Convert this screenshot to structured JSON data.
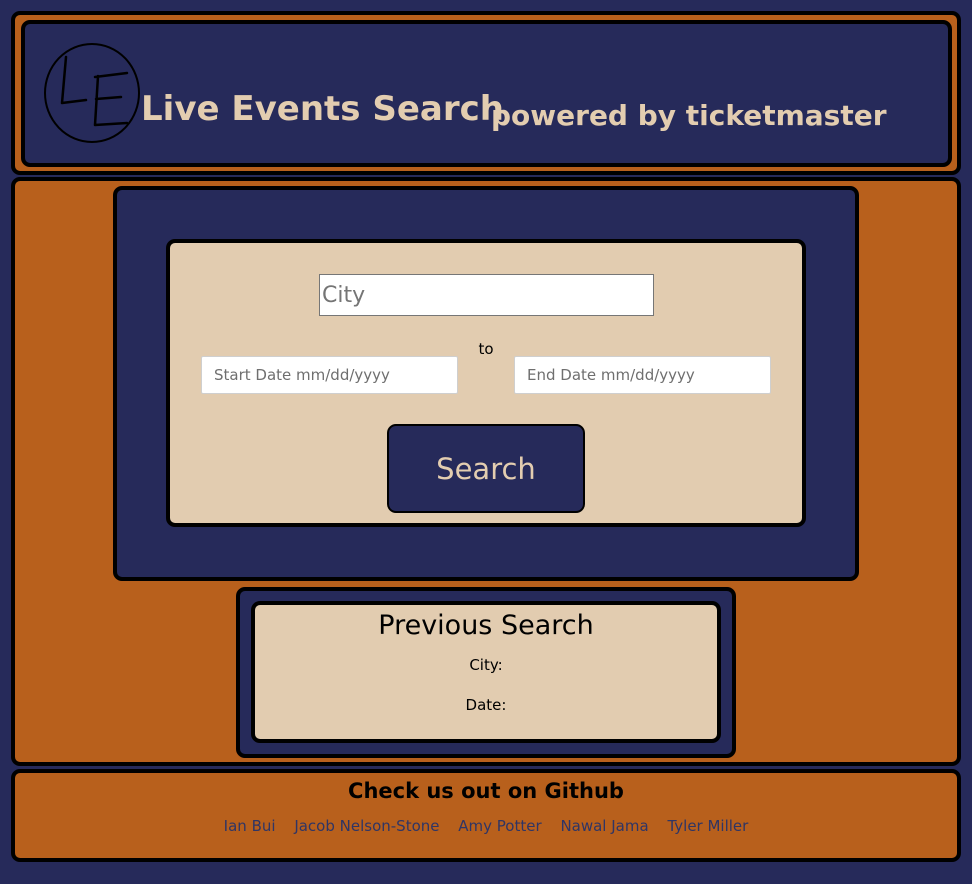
{
  "header": {
    "logo_text": "LE",
    "title": "Live Events Search",
    "subtitle": "powered by ticketmaster"
  },
  "search_form": {
    "city_placeholder": "City",
    "city_value": "",
    "start_date_placeholder": "Start Date mm/dd/yyyy",
    "start_date_value": "",
    "to_label": "to",
    "end_date_placeholder": "End Date mm/dd/yyyy",
    "end_date_value": "",
    "search_label": "Search"
  },
  "previous_search": {
    "title": "Previous Search",
    "city_label": "City:",
    "date_label": "Date:"
  },
  "footer": {
    "title": "Check us out on Github",
    "links": [
      "Ian Bui",
      "Jacob Nelson-Stone",
      "Amy Potter",
      "Nawal Jama",
      "Tyler Miller"
    ]
  },
  "colors": {
    "navy": "#262a5a",
    "orange": "#b8601c",
    "cream": "#e2ccb0",
    "title_text": "#e3cdb0"
  }
}
